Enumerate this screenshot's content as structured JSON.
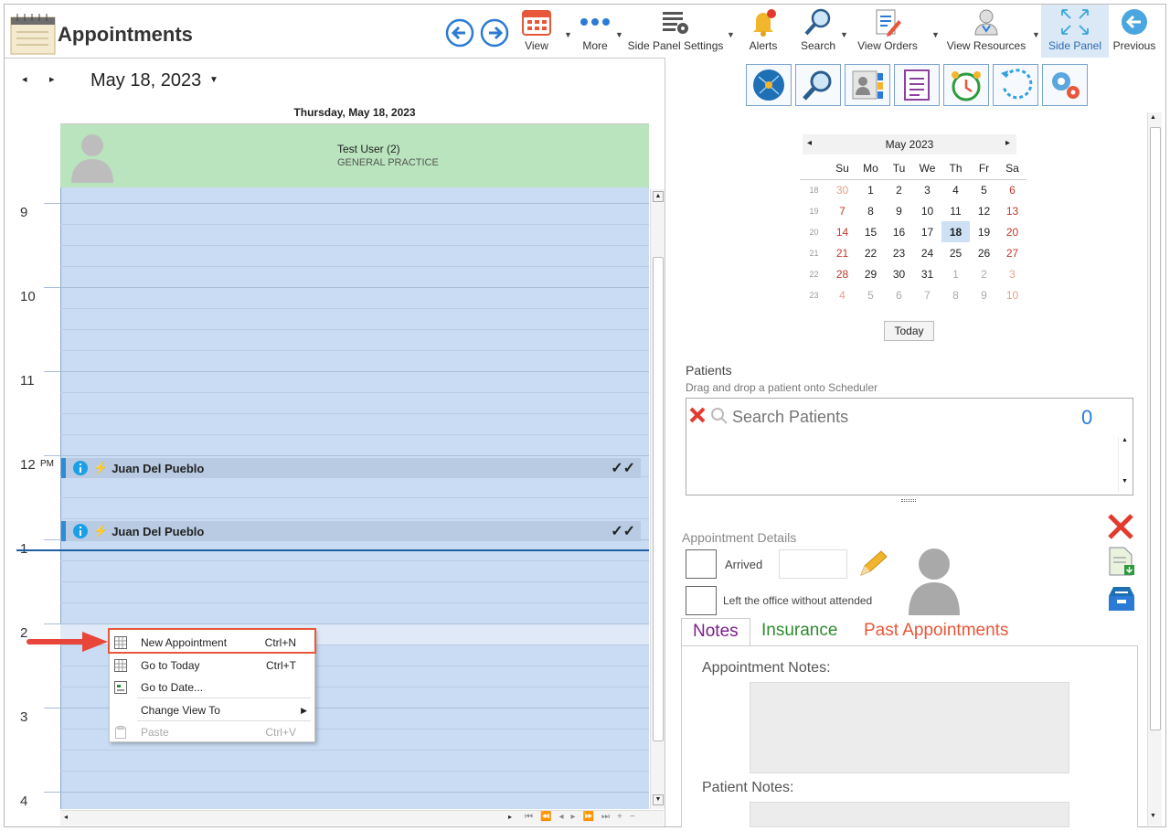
{
  "app": {
    "title": "Appointments"
  },
  "toolbar": {
    "view": "View",
    "more": "More",
    "side_panel_settings": "Side Panel Settings",
    "alerts": "Alerts",
    "search": "Search",
    "view_orders": "View Orders",
    "view_resources": "View Resources",
    "side_panel": "Side Panel",
    "previous": "Previous"
  },
  "scheduler": {
    "date_label": "May 18, 2023",
    "day_header": "Thursday, May 18, 2023",
    "resource_name": "Test User (2)",
    "resource_dept": "GENERAL PRACTICE",
    "hours": [
      "9",
      "10",
      "11",
      "12",
      "PM",
      "1",
      "2",
      "3",
      "4"
    ],
    "appointments": [
      {
        "name": "Juan Del Pueblo",
        "status": "✓✓"
      },
      {
        "name": "Juan Del Pueblo",
        "status": "✓✓"
      }
    ]
  },
  "context_menu": {
    "items": [
      {
        "label": "New Appointment",
        "shortcut": "Ctrl+N"
      },
      {
        "label": "Go to Today",
        "shortcut": "Ctrl+T"
      },
      {
        "label": "Go to Date..."
      },
      {
        "label": "Change View To"
      },
      {
        "label": "Paste",
        "shortcut": "Ctrl+V"
      }
    ]
  },
  "mini_calendar": {
    "title": "May 2023",
    "days": [
      "Su",
      "Mo",
      "Tu",
      "We",
      "Th",
      "Fr",
      "Sa"
    ],
    "weeks": [
      {
        "wk": "18",
        "d": [
          "30",
          "1",
          "2",
          "3",
          "4",
          "5",
          "6"
        ]
      },
      {
        "wk": "19",
        "d": [
          "7",
          "8",
          "9",
          "10",
          "11",
          "12",
          "13"
        ]
      },
      {
        "wk": "20",
        "d": [
          "14",
          "15",
          "16",
          "17",
          "18",
          "19",
          "20"
        ]
      },
      {
        "wk": "21",
        "d": [
          "21",
          "22",
          "23",
          "24",
          "25",
          "26",
          "27"
        ]
      },
      {
        "wk": "22",
        "d": [
          "28",
          "29",
          "30",
          "31",
          "1",
          "2",
          "3"
        ]
      },
      {
        "wk": "23",
        "d": [
          "4",
          "5",
          "6",
          "7",
          "8",
          "9",
          "10"
        ]
      }
    ],
    "today_label": "Today",
    "selected": "18"
  },
  "patients": {
    "title": "Patients",
    "hint": "Drag and drop a patient onto Scheduler",
    "search_placeholder": "Search Patients",
    "count": "0"
  },
  "appointment_details": {
    "title": "Appointment Details",
    "arrived": "Arrived",
    "left_office": "Left the office without attended"
  },
  "tabs": {
    "notes": "Notes",
    "insurance": "Insurance",
    "past": "Past Appointments"
  },
  "notes": {
    "appointment_notes": "Appointment Notes:",
    "patient_notes": "Patient Notes:"
  },
  "colors": {
    "accent": "#2b7bd6",
    "resource_bg": "#b9e4bd",
    "timeline_bg": "#c9dcf3",
    "weekend_red": "#c0392b",
    "tab_notes": "#7a1f8a",
    "tab_insurance": "#2e8b2e",
    "tab_past": "#e8573a"
  }
}
